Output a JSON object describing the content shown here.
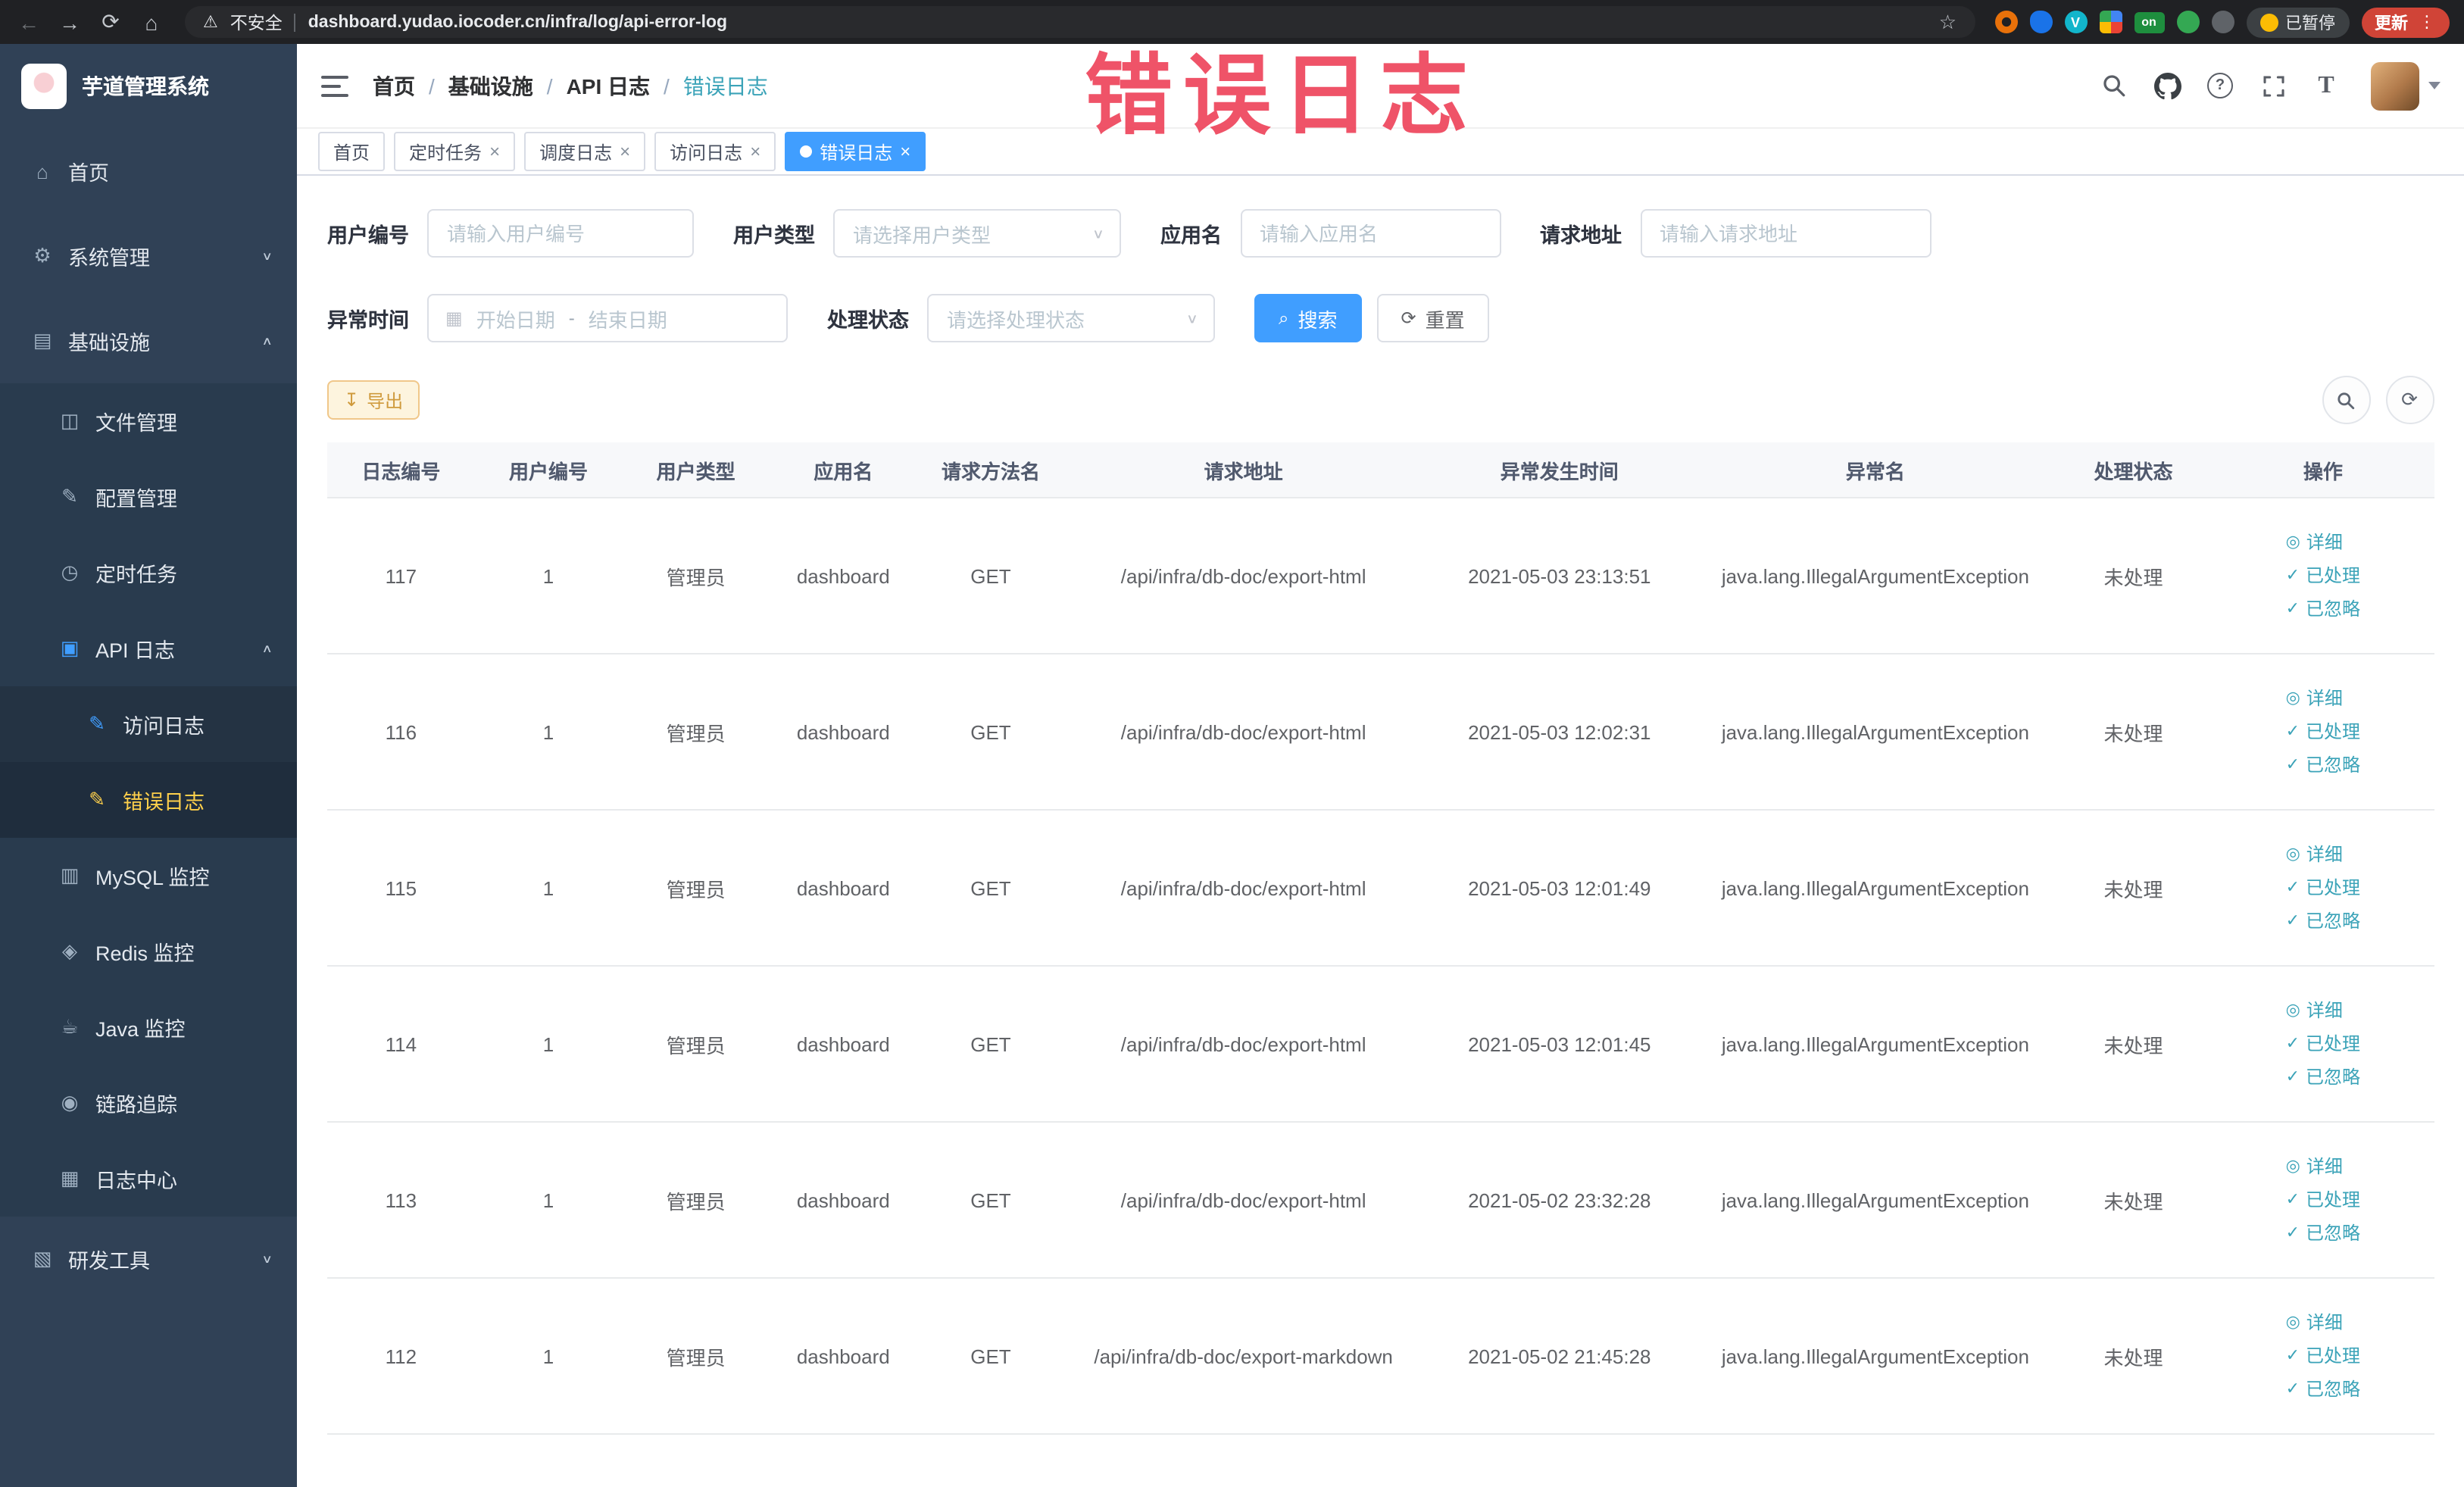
{
  "colors": {
    "accent_blue": "#409eff",
    "link_teal": "#3ba3b8",
    "sidebar_bg": "#304156",
    "sidebar_active_text": "#ffd04b",
    "warning_orange": "#e6a23c",
    "watermark_red": "#ee4158",
    "browser_bar": "#202124"
  },
  "browser": {
    "security_label": "不安全",
    "url": "dashboard.yudao.iocoder.cn/infra/log/api-error-log",
    "extension_on_badge": "on",
    "paused_label": "已暂停",
    "update_label": "更新"
  },
  "watermark": "错误日志",
  "icons": {
    "back": "←",
    "forward": "→",
    "reload": "⟳",
    "home": "⌂",
    "warning": "⚠",
    "star": "☆",
    "menu_dots": "⋮",
    "sidebar_home": "⌂",
    "gear": "⚙",
    "infra": "▤",
    "file": "◫",
    "config": "✎",
    "timer": "◷",
    "api_log": "▣",
    "doc_edit": "✎",
    "mysql": "▥",
    "redis": "◈",
    "java": "☕",
    "trace": "◉",
    "log_center": "▦",
    "devtools": "▧",
    "chevron_down": "∨",
    "chevron_up": "∧",
    "close": "×",
    "calendar": "▦",
    "eye": "◎",
    "check": "✓",
    "download": "↧",
    "refresh": "⟳",
    "search": "⌕"
  },
  "sidebar": {
    "logo_title": "芋道管理系统",
    "items": [
      {
        "label": "首页"
      },
      {
        "label": "系统管理"
      },
      {
        "label": "基础设施"
      },
      {
        "label": "文件管理"
      },
      {
        "label": "配置管理"
      },
      {
        "label": "定时任务"
      },
      {
        "label": "API 日志"
      },
      {
        "label": "访问日志"
      },
      {
        "label": "错误日志"
      },
      {
        "label": "MySQL 监控"
      },
      {
        "label": "Redis 监控"
      },
      {
        "label": "Java 监控"
      },
      {
        "label": "链路追踪"
      },
      {
        "label": "日志中心"
      },
      {
        "label": "研发工具"
      }
    ]
  },
  "header": {
    "breadcrumb": [
      "首页",
      "基础设施",
      "API 日志",
      "错误日志"
    ],
    "breadcrumb_separator": "/"
  },
  "tabs": [
    {
      "label": "首页"
    },
    {
      "label": "定时任务"
    },
    {
      "label": "调度日志"
    },
    {
      "label": "访问日志"
    },
    {
      "label": "错误日志"
    }
  ],
  "filters": {
    "user_id_label": "用户编号",
    "user_id_placeholder": "请输入用户编号",
    "user_type_label": "用户类型",
    "user_type_placeholder": "请选择用户类型",
    "app_name_label": "应用名",
    "app_name_placeholder": "请输入应用名",
    "request_url_label": "请求地址",
    "request_url_placeholder": "请输入请求地址",
    "exception_time_label": "异常时间",
    "start_date_placeholder": "开始日期",
    "range_separator": "-",
    "end_date_placeholder": "结束日期",
    "process_status_label": "处理状态",
    "process_status_placeholder": "请选择处理状态",
    "search_button": "搜索",
    "reset_button": "重置"
  },
  "toolbar": {
    "export_button": "导出"
  },
  "table": {
    "columns": [
      "日志编号",
      "用户编号",
      "用户类型",
      "应用名",
      "请求方法名",
      "请求地址",
      "异常发生时间",
      "异常名",
      "处理状态",
      "操作"
    ],
    "actions": {
      "detail": "详细",
      "processed": "已处理",
      "ignored": "已忽略"
    },
    "rows": [
      {
        "log_id": "117",
        "user_id": "1",
        "user_type": "管理员",
        "app_name": "dashboard",
        "method": "GET",
        "url": "/api/infra/db-doc/export-html",
        "time": "2021-05-03 23:13:51",
        "exception": "java.lang.IllegalArgumentException",
        "status": "未处理"
      },
      {
        "log_id": "116",
        "user_id": "1",
        "user_type": "管理员",
        "app_name": "dashboard",
        "method": "GET",
        "url": "/api/infra/db-doc/export-html",
        "time": "2021-05-03 12:02:31",
        "exception": "java.lang.IllegalArgumentException",
        "status": "未处理"
      },
      {
        "log_id": "115",
        "user_id": "1",
        "user_type": "管理员",
        "app_name": "dashboard",
        "method": "GET",
        "url": "/api/infra/db-doc/export-html",
        "time": "2021-05-03 12:01:49",
        "exception": "java.lang.IllegalArgumentException",
        "status": "未处理"
      },
      {
        "log_id": "114",
        "user_id": "1",
        "user_type": "管理员",
        "app_name": "dashboard",
        "method": "GET",
        "url": "/api/infra/db-doc/export-html",
        "time": "2021-05-03 12:01:45",
        "exception": "java.lang.IllegalArgumentException",
        "status": "未处理"
      },
      {
        "log_id": "113",
        "user_id": "1",
        "user_type": "管理员",
        "app_name": "dashboard",
        "method": "GET",
        "url": "/api/infra/db-doc/export-html",
        "time": "2021-05-02 23:32:28",
        "exception": "java.lang.IllegalArgumentException",
        "status": "未处理"
      },
      {
        "log_id": "112",
        "user_id": "1",
        "user_type": "管理员",
        "app_name": "dashboard",
        "method": "GET",
        "url": "/api/infra/db-doc/export-markdown",
        "time": "2021-05-02 21:45:28",
        "exception": "java.lang.IllegalArgumentException",
        "status": "未处理"
      }
    ]
  }
}
